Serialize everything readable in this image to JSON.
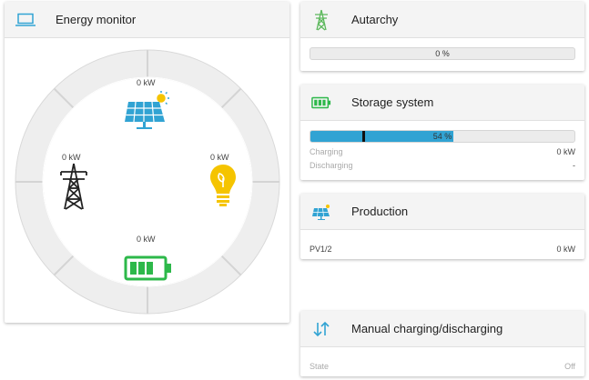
{
  "energy_monitor": {
    "title": "Energy monitor",
    "production_value": "0 kW",
    "grid_value": "0 kW",
    "consumption_value": "0 kW",
    "storage_value": "0 kW"
  },
  "autarchy": {
    "title": "Autarchy",
    "percent_text": "0 %",
    "percent": 0
  },
  "storage": {
    "title": "Storage system",
    "percent_text": "54 %",
    "percent": 54,
    "charging_label": "Charging",
    "charging_value": "0 kW",
    "discharging_label": "Discharging",
    "discharging_value": "-"
  },
  "production": {
    "title": "Production",
    "pv_label": "PV1/2",
    "pv_value": "0 kW"
  },
  "manual": {
    "title": "Manual charging/discharging",
    "state_label": "State",
    "state_value": "Off"
  },
  "colors": {
    "accent_blue": "#31a3d3",
    "battery_green": "#2db84a",
    "bulb_yellow": "#f5c400",
    "tower_green": "#5cb85c"
  }
}
